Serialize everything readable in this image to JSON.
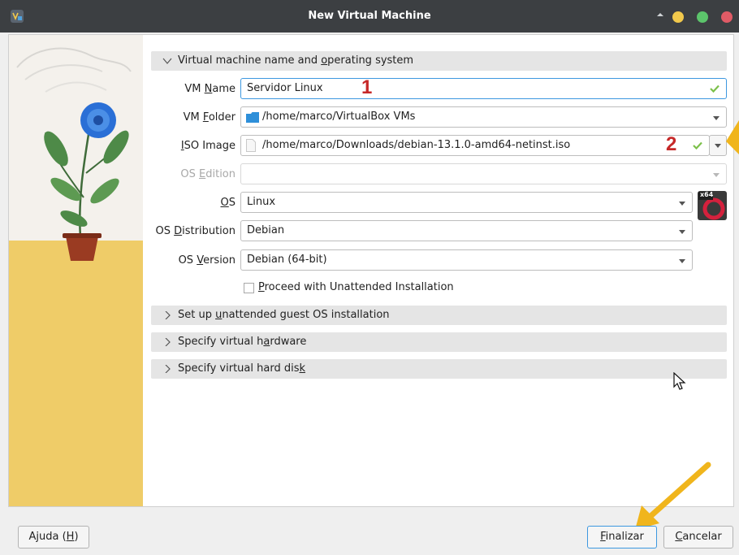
{
  "window": {
    "title": "New Virtual Machine"
  },
  "sections": {
    "name_os": {
      "pre": "Virtual machine name and ",
      "u": "o",
      "post": "perating system"
    },
    "unattended": {
      "pre": "Set up ",
      "u": "u",
      "post": "nattended guest OS installation"
    },
    "hardware": {
      "pre": "Specify virtual h",
      "u": "a",
      "post": "rdware"
    },
    "disk": {
      "pre": "Specify virtual hard dis",
      "u": "k",
      "post": ""
    }
  },
  "form": {
    "vm_name": {
      "label_pre": "VM ",
      "label_u": "N",
      "label_post": "ame",
      "value": "Servidor Linux"
    },
    "vm_folder": {
      "label_pre": "VM ",
      "label_u": "F",
      "label_post": "older",
      "value": "/home/marco/VirtualBox VMs"
    },
    "iso_image": {
      "label_pre": "",
      "label_u": "I",
      "label_post": "SO Image",
      "value": "/home/marco/Downloads/debian-13.1.0-amd64-netinst.iso"
    },
    "os_edition": {
      "label_pre": "OS ",
      "label_u": "E",
      "label_post": "dition",
      "value": ""
    },
    "os": {
      "label_pre": "",
      "label_u": "O",
      "label_post": "S",
      "value": "Linux"
    },
    "os_distribution": {
      "label_pre": "OS ",
      "label_u": "D",
      "label_post": "istribution",
      "value": "Debian"
    },
    "os_version": {
      "label_pre": "OS ",
      "label_u": "V",
      "label_post": "ersion",
      "value": "Debian (64-bit)"
    },
    "unattended": {
      "label_pre": "",
      "label_u": "P",
      "label_post": "roceed with Unattended Installation",
      "checked": false
    }
  },
  "os_badge": "x64",
  "annotations": {
    "mark1": "1",
    "mark2": "2"
  },
  "buttons": {
    "help": {
      "pre": "Ajuda (",
      "u": "H",
      "post": ")"
    },
    "finish": {
      "pre": "",
      "u": "F",
      "post": "inalizar"
    },
    "cancel": {
      "pre": "",
      "u": "C",
      "post": "ancelar"
    }
  },
  "colors": {
    "accent": "#3d98e0",
    "annotation_red": "#c62828",
    "arrow_yellow": "#f0b51c"
  }
}
